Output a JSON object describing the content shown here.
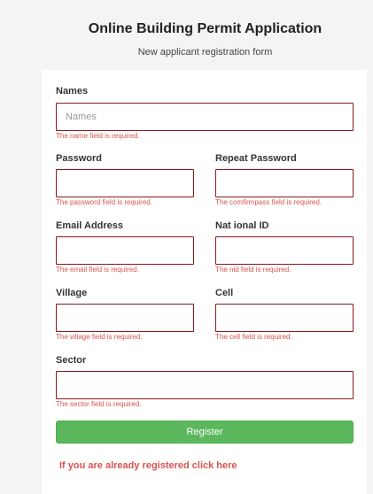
{
  "header": {
    "title": "Online Building Permit Application",
    "subtitle": "New applicant registration form"
  },
  "form": {
    "names": {
      "label": "Names",
      "placeholder": "Names",
      "value": "",
      "error": "The name field is required."
    },
    "password": {
      "label": "Password",
      "value": "",
      "error": "The password field is required."
    },
    "repeat_password": {
      "label": "Repeat Password",
      "value": "",
      "error": "The comfirmpass field is required."
    },
    "email": {
      "label": "Email Address",
      "value": "",
      "error": "The email field is required."
    },
    "national_id": {
      "label": "Nat ional ID",
      "value": "",
      "error": "The nid field is required."
    },
    "village": {
      "label": "Village",
      "value": "",
      "error": "The village field is required."
    },
    "cell": {
      "label": "Cell",
      "value": "",
      "error": "The cell field is required."
    },
    "sector": {
      "label": "Sector",
      "value": "",
      "error": "The sector field is required."
    },
    "register_label": "Register",
    "login_link": "If you are already registered click here"
  },
  "colors": {
    "error": "#d9534f",
    "input_border": "#8b1a1a",
    "button": "#5cb85c"
  }
}
